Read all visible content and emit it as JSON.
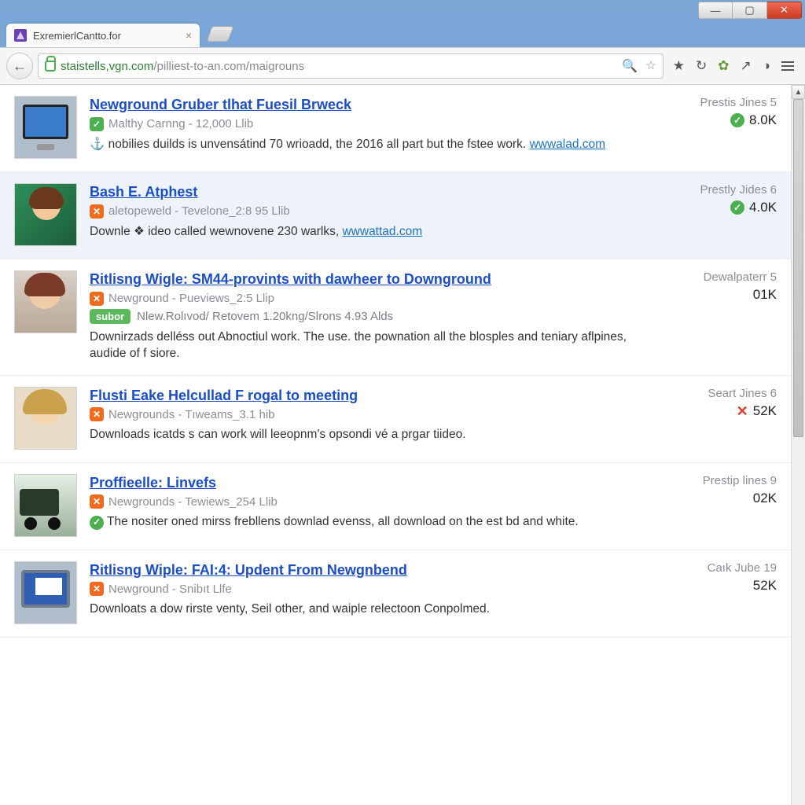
{
  "window": {
    "tab_title": "ExremierlCantto.for"
  },
  "urlbar": {
    "domain": "staistells,vgn.com",
    "path": "/pilliest-to-an.com/maigrouns"
  },
  "items": [
    {
      "title": "Newground Gruber tlhat Fuesil Brweck",
      "author": "Malthy Carnng",
      "subinfo": "12,000 Llib",
      "sub_badge": "green",
      "desc_prefix": "nobilies duilds is unvensátind 70 wrioadd, the 2016 all part but the fstee work.",
      "desc_link": "wwwalad.com",
      "meta1": "Prestis Jines 5",
      "meta2": "8.0K",
      "meta_status": "ok",
      "thumb": "thumb-monitor",
      "highlight": false,
      "anchor_icon": true
    },
    {
      "title": "Bash E. Atphest",
      "author": "aletopeweld",
      "subinfo": "Tevelone_2:8 95 Llib",
      "sub_badge": "orange",
      "desc_prefix": "Downle ❖ ideo called wewnovene 230 warlks,",
      "desc_link": "wwwattad.com",
      "meta1": "Prestly Jides 6",
      "meta2": "4.0K",
      "meta_status": "ok",
      "thumb": "thumb-avatar1",
      "highlight": true
    },
    {
      "title": "Ritlisng Wigle: SM44-provints with dawheer to Downground",
      "author": "Newground",
      "subinfo": "Pueviews_2:5 Llip",
      "sub_badge": "orange",
      "tag": "subor",
      "sub2": "Nlew.Rolıvod/ Retovem 1.20kng/Slrons 4.93 Alds",
      "desc_prefix": "Downirzads delléss out Abnoctiul work. The use. the pownation all the blosples and teniary aflpines, audide of f siore.",
      "meta1": "Dewalpaterr 5",
      "meta2": "01K",
      "meta_status": "none",
      "thumb": "thumb-photo1",
      "highlight": false
    },
    {
      "title": "Flusti Eake Helcullad F rogal to meeting",
      "author": "Newgrounds",
      "subinfo": "Tıweams_3.1 hib",
      "sub_badge": "orange",
      "desc_prefix": "Downloads icatds s can work will leeopnm's opsondi vé a prgar tiideo.",
      "meta1": "Seart Jines 6",
      "meta2": "52K",
      "meta_status": "bad",
      "thumb": "thumb-photo2",
      "highlight": false
    },
    {
      "title": "Proffieelle: Linvefs",
      "author": "Newgrounds",
      "subinfo": "Tewiews_254 Llib",
      "sub_badge": "orange",
      "desc_prefix": "The nositer oned mirss frebllens downlad evenss, all download on the est bd and white.",
      "desc_status": "ok",
      "meta1": "Prestip lines 9",
      "meta2": "02K",
      "meta_status": "none",
      "thumb": "thumb-truck",
      "highlight": false
    },
    {
      "title": "Ritlisng Wiple: FAI:4: Updent From Newgnbend",
      "author": "Newground",
      "subinfo": "Snibıt Llfe",
      "sub_badge": "orange",
      "desc_prefix": "Downloats a dow rirste venty, Seil other, and waiple relectoon Conpolmed.",
      "meta1": "Caık Jube 19",
      "meta2": "52K",
      "meta_status": "none",
      "thumb": "thumb-pc",
      "highlight": false
    }
  ]
}
